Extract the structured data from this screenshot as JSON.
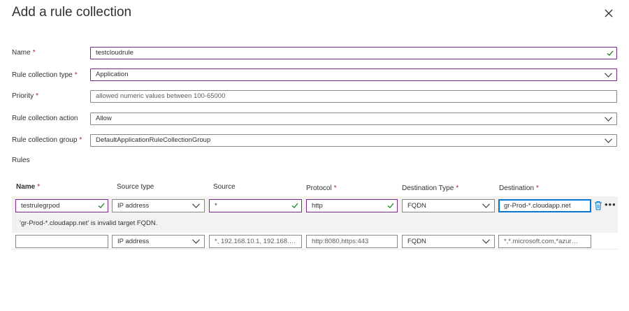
{
  "panel": {
    "title": "Add a rule collection"
  },
  "form": {
    "name": {
      "label": "Name",
      "value": "testcloudrule"
    },
    "type": {
      "label": "Rule collection type",
      "value": "Application"
    },
    "priority": {
      "label": "Priority",
      "placeholder": "allowed numeric values between 100-65000"
    },
    "action": {
      "label": "Rule collection action",
      "value": "Allow"
    },
    "group": {
      "label": "Rule collection group",
      "value": "DefaultApplicationRuleCollectionGroup"
    },
    "required_mark": "*"
  },
  "rules": {
    "label": "Rules",
    "columns": {
      "name": "Name",
      "source_type": "Source type",
      "source": "Source",
      "protocol": "Protocol",
      "dest_type": "Destination Type",
      "destination": "Destination"
    },
    "row1": {
      "name": "testrulegrpod",
      "source_type": "IP address",
      "source": "*",
      "protocol": "http",
      "dest_type": "FQDN",
      "destination": "gr-Prod-*.cloudapp.net",
      "error": "'gr-Prod-*.cloudapp.net' is invalid target FQDN.",
      "more": "•••"
    },
    "row2": {
      "name": "",
      "source_type": "IP address",
      "source_placeholder": "*, 192.168.10.1, 192.168.…",
      "protocol_placeholder": "http:8080,https:443",
      "dest_type": "FQDN",
      "destination_placeholder": "*,*.microsoft.com,*azur…"
    }
  },
  "colors": {
    "valid_border": "#7a2a8a",
    "focus_border": "#0078d4",
    "required": "#a4262c",
    "check": "#107c10",
    "trash": "#0078d4"
  }
}
